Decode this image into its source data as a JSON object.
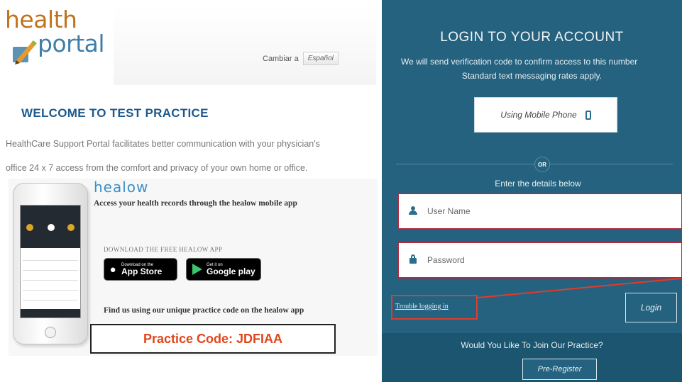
{
  "logo": {
    "line1": "health",
    "line2": "portal"
  },
  "language": {
    "label": "Cambiar a",
    "button": "Español"
  },
  "welcome": {
    "title": "WELCOME TO TEST PRACTICE",
    "desc_line1": "HealthCare Support Portal facilitates better communication with your physician's",
    "desc_line2": "office 24 x 7 access from the comfort and privacy of your own home or office."
  },
  "promo": {
    "brand": "healow",
    "tagline": "Access your health records through the healow mobile app",
    "download": "DOWNLOAD THE FREE HEALOW APP",
    "app_store_small": "Download on the",
    "app_store_big": "App Store",
    "google_small": "Get it on",
    "google_big": "Google play",
    "find_us": "Find us using our unique practice code on the healow app",
    "practice_code": "Practice Code: JDFIAA"
  },
  "login": {
    "title": "LOGIN TO YOUR ACCOUNT",
    "sub1": "We will send verification code to confirm access to this number",
    "sub2": "Standard text messaging rates apply.",
    "mobile_button": "Using Mobile Phone",
    "or": "OR",
    "enter_details": "Enter the details below",
    "username_placeholder": "User Name",
    "password_placeholder": "Password",
    "trouble": "Trouble logging in",
    "login_button": "Login",
    "join": "Would You Like To Join Our Practice?",
    "preregister": "Pre-Register"
  },
  "colors": {
    "panel": "#24627f",
    "field_border": "#b22a3e",
    "highlight": "#e23b2a",
    "code_text": "#e0461b"
  }
}
